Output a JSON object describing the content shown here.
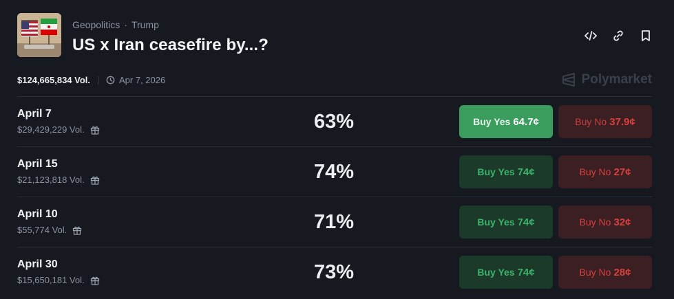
{
  "header": {
    "breadcrumb": [
      "Geopolitics",
      "Trump"
    ],
    "breadcrumb_sep": "·",
    "title": "US x Iran ceasefire by...?",
    "total_volume": "$124,665,834 Vol.",
    "end_date": "Apr 7, 2026",
    "brand": "Polymarket",
    "actions": [
      "embed-icon",
      "link-icon",
      "bookmark-icon"
    ]
  },
  "colors": {
    "yes_active": "#3a9c5d",
    "yes": "#1b3a2a",
    "no": "#3b1f22",
    "yes_text": "#3bb36b",
    "no_text": "#d9403e"
  },
  "outcomes": [
    {
      "label": "April 7",
      "volume": "$29,429,229 Vol.",
      "chance": "63%",
      "yes_label": "Buy Yes",
      "yes_price": "64.7¢",
      "no_label": "Buy No",
      "no_price": "37.9¢"
    },
    {
      "label": "April 15",
      "volume": "$21,123,818 Vol.",
      "chance": "74%",
      "yes_label": "Buy Yes",
      "yes_price": "74¢",
      "no_label": "Buy No",
      "no_price": "27¢"
    },
    {
      "label": "April 10",
      "volume": "$55,774 Vol.",
      "chance": "71%",
      "yes_label": "Buy Yes",
      "yes_price": "74¢",
      "no_label": "Buy No",
      "no_price": "32¢"
    },
    {
      "label": "April 30",
      "volume": "$15,650,181 Vol.",
      "chance": "73%",
      "yes_label": "Buy Yes",
      "yes_price": "74¢",
      "no_label": "Buy No",
      "no_price": "28¢"
    }
  ]
}
